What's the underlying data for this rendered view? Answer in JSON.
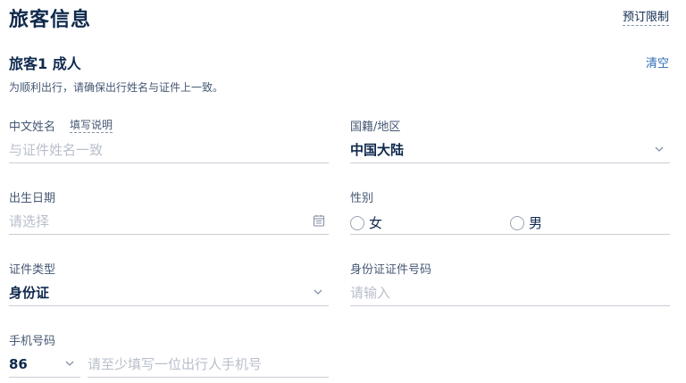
{
  "header": {
    "title": "旅客信息",
    "booking_limit": "预订限制"
  },
  "traveler": {
    "title": "旅客1 成人",
    "clear": "清空",
    "hint": "为顺利出行，请确保出行姓名与证件上一致。"
  },
  "fields": {
    "chinese_name": {
      "label": "中文姓名",
      "help": "填写说明",
      "placeholder": "与证件姓名一致"
    },
    "nationality": {
      "label": "国籍/地区",
      "value": "中国大陆"
    },
    "birth_date": {
      "label": "出生日期",
      "placeholder": "请选择"
    },
    "gender": {
      "label": "性别",
      "options": [
        "女",
        "男"
      ]
    },
    "id_type": {
      "label": "证件类型",
      "value": "身份证"
    },
    "id_number": {
      "label": "身份证证件号码",
      "placeholder": "请输入"
    },
    "phone": {
      "label": "手机号码",
      "code": "86",
      "placeholder": "请至少填写一位出行人手机号"
    }
  },
  "icons": {
    "chevron": "chevron-down-icon",
    "calendar": "calendar-icon"
  }
}
